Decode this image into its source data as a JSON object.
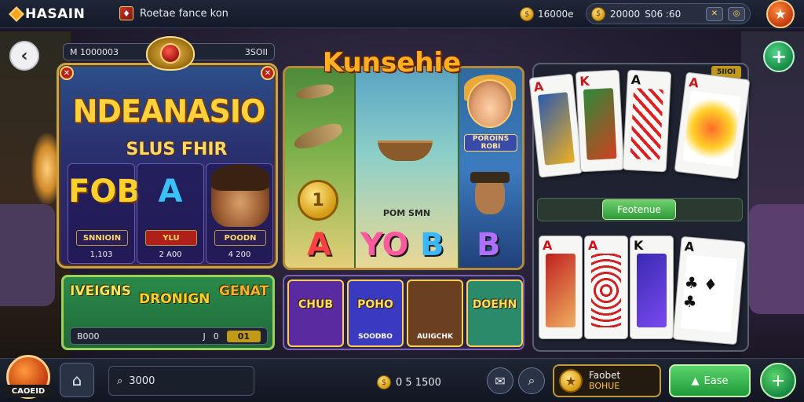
{
  "header": {
    "logo_text": "HASAIN",
    "game_name": "Roetae fance kon",
    "coins_a": "16000e",
    "wallet_value_1": "20000",
    "wallet_value_2": "S06 :60",
    "wallet_icon": "coin-icon",
    "star_icon": "star-icon"
  },
  "left_panel": {
    "header_left": "M  1000003",
    "header_right": "3SOII",
    "title": "NDEANASIO",
    "subtitle": "SLUS FHIR",
    "reels": [
      {
        "symbol": "FOB",
        "tag": "SNNIOIN",
        "value": "1,103",
        "color": "#ffcf2a"
      },
      {
        "symbol": "A",
        "tag": "YLU",
        "value": "2 A00",
        "color": "#3cc0f5"
      },
      {
        "symbol": "",
        "tag": "POODN",
        "value": "4 200",
        "color": "#ffffff"
      }
    ]
  },
  "center_panel": {
    "title": "Kunsehie",
    "small_label": "POM SMN",
    "letters": [
      {
        "text": "A",
        "color": "#ff4040"
      },
      {
        "text": "YO",
        "color": "#ff5aa0"
      },
      {
        "text": "B",
        "color": "#3ab8ff"
      },
      {
        "text": "B",
        "color": "#b070ff"
      }
    ],
    "coin_symbol": "1",
    "portrait_label": "POROINS ROBI"
  },
  "bonus_row": {
    "items": [
      "IVEIGNS",
      "DRONIGN",
      "GENAT"
    ],
    "bar_left": "B000",
    "bar_mid_a": "J",
    "bar_mid_b": "0",
    "bar_right": "01"
  },
  "mini_row": {
    "items": [
      {
        "label": "CHUB",
        "sub": "",
        "bg": "#5a2aa0"
      },
      {
        "label": "POHO",
        "sub": "SOODBO",
        "bg": "#3a3ac0"
      },
      {
        "label": "",
        "sub": "AUIGCHK",
        "bg": "#6a4020"
      },
      {
        "label": "DOEHN",
        "sub": "",
        "bg": "#2a8a6a"
      }
    ]
  },
  "card_panel": {
    "tag": "5IIOI",
    "feature_label": "Feotenue",
    "top_cards": [
      "A",
      "K",
      "A",
      "A"
    ],
    "bottom_cards": [
      "A",
      "A",
      "K",
      "A"
    ]
  },
  "bottom_bar": {
    "logo_label": "CAOEID",
    "search_value": "3000",
    "coins": "0 5 1500",
    "promo_title": "Faobet",
    "promo_sub": "BOHUE",
    "action_label": "Ease",
    "menu_icon": "plus-icon"
  }
}
